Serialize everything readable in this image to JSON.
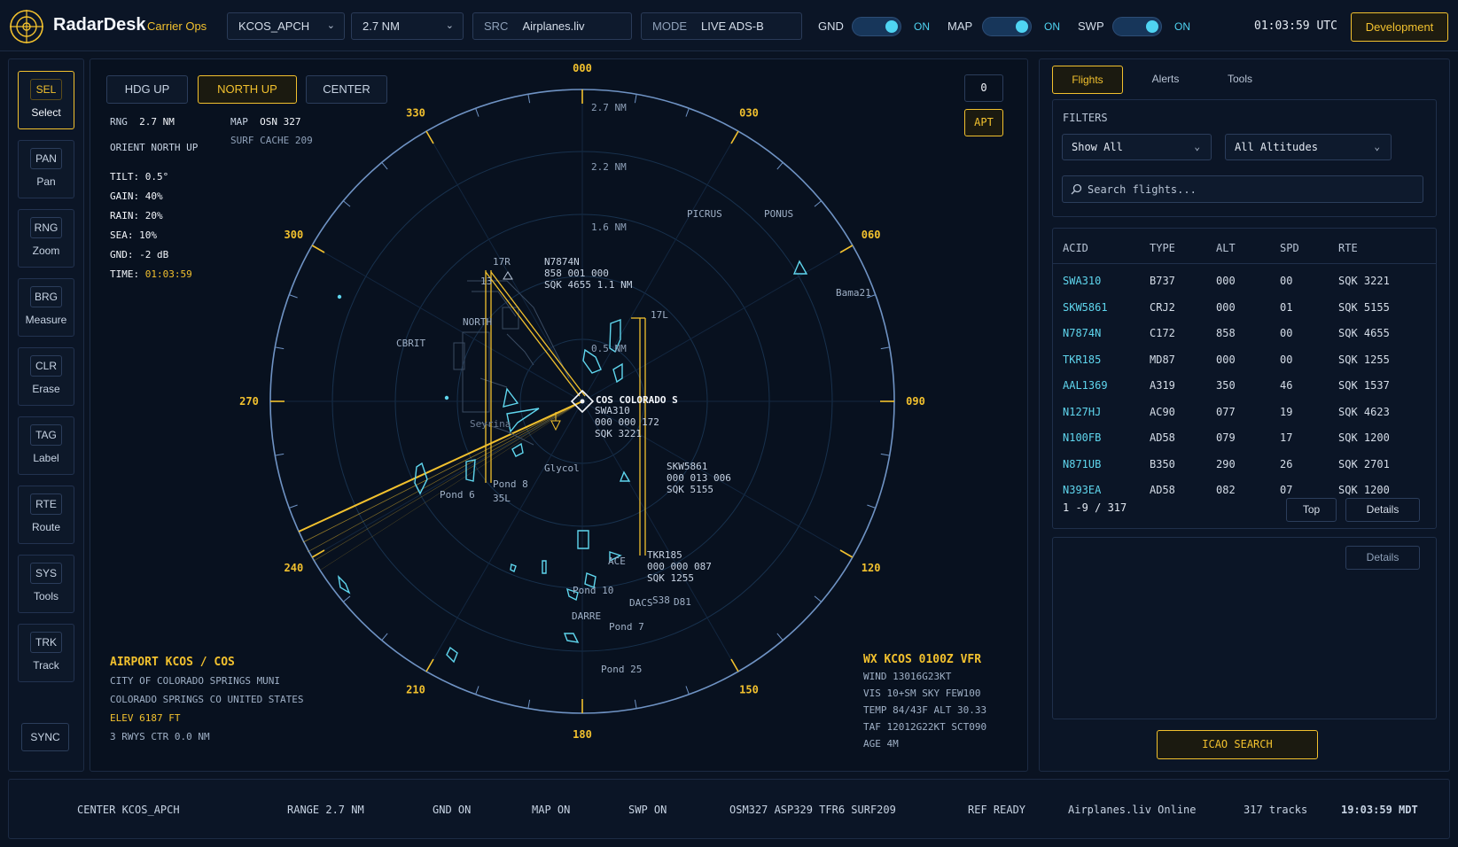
{
  "header": {
    "brand": "RadarDesk",
    "brand_sub": "Carrier Ops",
    "facility": "KCOS_APCH",
    "range": "2.7 NM",
    "src_label": "SRC",
    "src_value": "Airplanes.liv",
    "mode_label": "MODE",
    "mode_value": "LIVE ADS-B",
    "toggles": [
      {
        "label": "GND",
        "state": "ON"
      },
      {
        "label": "MAP",
        "state": "ON"
      },
      {
        "label": "SWP",
        "state": "ON"
      }
    ],
    "clock": "01:03:59 UTC",
    "env_button": "Development"
  },
  "tools": [
    {
      "code": "SEL",
      "name": "Select",
      "active": true
    },
    {
      "code": "PAN",
      "name": "Pan"
    },
    {
      "code": "RNG",
      "name": "Zoom"
    },
    {
      "code": "BRG",
      "name": "Measure"
    },
    {
      "code": "CLR",
      "name": "Erase"
    },
    {
      "code": "TAG",
      "name": "Label"
    },
    {
      "code": "RTE",
      "name": "Route"
    },
    {
      "code": "SYS",
      "name": "Tools"
    },
    {
      "code": "TRK",
      "name": "Track"
    }
  ],
  "sync_label": "SYNC",
  "radar": {
    "orient_buttons": [
      {
        "label": "HDG UP"
      },
      {
        "label": "NORTH UP",
        "active": true
      },
      {
        "label": "CENTER"
      }
    ],
    "zero_button": "0",
    "apt_button": "APT",
    "info": {
      "rng_label": "RNG",
      "rng_value": "2.7 NM",
      "map_label": "MAP",
      "map_value": "OSN  327",
      "orient": "ORIENT NORTH UP",
      "surf": "SURF CACHE 209",
      "tilt": "TILT: 0.5°",
      "gain": "GAIN: 40%",
      "rain": "RAIN: 20%",
      "sea": "SEA: 10%",
      "gnd": "GND: -2 dB",
      "time_label": "TIME:",
      "time_value": "01:03:59"
    },
    "bearings": [
      "000",
      "030",
      "060",
      "090",
      "120",
      "150",
      "180",
      "210",
      "240",
      "270",
      "300",
      "330"
    ],
    "range_labels": [
      "2.7 NM",
      "2.2 NM",
      "1.6 NM",
      "0.5 NM"
    ],
    "map_labels": [
      "PICRUS",
      "PONUS",
      "CBRIT",
      "NORTH",
      "17R",
      "13",
      "17L",
      "Glycol",
      "Pond 6",
      "Pond 8",
      "35L",
      "Pond 10",
      "Pond 7",
      "Pond 25",
      "DARRE",
      "ACE",
      "D81",
      "Bama21",
      "S38",
      "DACS",
      "Seyrina"
    ],
    "center_label": "COS COLORADO S",
    "tracks": [
      {
        "acid": "N7874N",
        "line2": "858 001 000",
        "line3": "SQK 4655 1.1 NM"
      },
      {
        "acid": "SWA310",
        "line2": "000 000 172",
        "line3": "SQK 3221"
      },
      {
        "acid": "SKW5861",
        "line2": "000 013 006",
        "line3": "SQK 5155"
      },
      {
        "acid": "TKR185",
        "line2": "000 000 087",
        "line3": "SQK 1255"
      }
    ],
    "airport": {
      "title": "AIRPORT KCOS / COS",
      "name": "CITY OF COLORADO SPRINGS MUNI",
      "city": "COLORADO SPRINGS CO UNITED STATES",
      "elev": "ELEV 6187 FT",
      "rwys": "3 RWYS  CTR 0.0 NM"
    },
    "wx": {
      "title": "WX KCOS 0100Z VFR",
      "wind": "WIND 13016G23KT",
      "vis": "VIS 10+SM  SKY FEW100",
      "temp": "TEMP 84/43F  ALT 30.33",
      "taf": "TAF 12012G22KT SCT090",
      "age": "AGE 4M"
    }
  },
  "right": {
    "tabs": [
      {
        "label": "Flights",
        "active": true
      },
      {
        "label": "Alerts"
      },
      {
        "label": "Tools"
      }
    ],
    "filters_title": "FILTERS",
    "show_filter": "Show All",
    "alt_filter": "All Altitudes",
    "search_placeholder": "Search flights...",
    "columns": [
      "ACID",
      "TYPE",
      "ALT",
      "SPD",
      "RTE"
    ],
    "flights": [
      [
        "SWA310",
        "B737",
        "000",
        "00",
        "SQK 3221"
      ],
      [
        "SKW5861",
        "CRJ2",
        "000",
        "01",
        "SQK 5155"
      ],
      [
        "N7874N",
        "C172",
        "858",
        "00",
        "SQK 4655"
      ],
      [
        "TKR185",
        "MD87",
        "000",
        "00",
        "SQK 1255"
      ],
      [
        "AAL1369",
        "A319",
        "350",
        "46",
        "SQK 1537"
      ],
      [
        "N127HJ",
        "AC90",
        "077",
        "19",
        "SQK 4623"
      ],
      [
        "N100FB",
        "AD58",
        "079",
        "17",
        "SQK 1200"
      ],
      [
        "N871UB",
        "B350",
        "290",
        "26",
        "SQK 2701"
      ],
      [
        "N393EA",
        "AD58",
        "082",
        "07",
        "SQK 1200"
      ]
    ],
    "pager": "1 -9 / 317",
    "top_button": "Top",
    "details_button": "Details",
    "detail_panel_button": "Details",
    "icao_button": "ICAO SEARCH"
  },
  "status": {
    "center": "CENTER KCOS_APCH",
    "range": "RANGE 2.7 NM",
    "gnd": "GND ON",
    "map": "MAP ON",
    "swp": "SWP ON",
    "layers": "OSM327  ASP329  TFR6  SURF209",
    "ref": "REF READY",
    "source": "Airplanes.liv  Online",
    "tracks": "317 tracks",
    "local_time": "19:03:59 MDT"
  }
}
